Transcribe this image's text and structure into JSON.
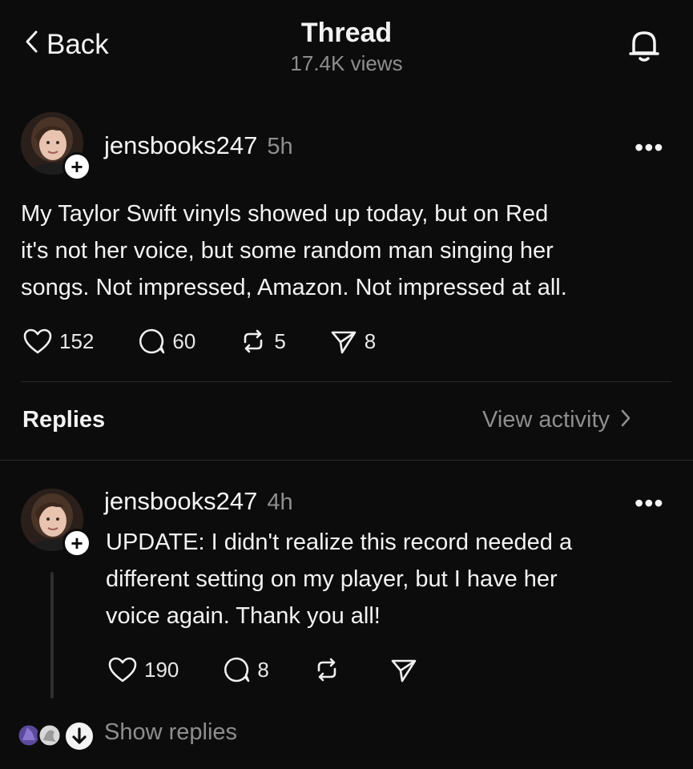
{
  "header": {
    "back_label": "Back",
    "title": "Thread",
    "views": "17.4K views",
    "icons": {
      "back": "chevron-left-icon",
      "notifications": "bell-icon"
    }
  },
  "post": {
    "username": "jensbooks247",
    "time": "5h",
    "more": "•••",
    "text_lines": [
      "My Taylor Swift vinyls showed up today, but on Red",
      "it's not her voice, but some random man singing her",
      "songs. Not impressed, Amazon. Not impressed at all."
    ],
    "likes": "152",
    "comments": "60",
    "reposts": "5",
    "shares": "8"
  },
  "replies_section": {
    "label": "Replies",
    "view_activity": "View activity"
  },
  "reply": {
    "username": "jensbooks247",
    "time": "4h",
    "more": "•••",
    "text_lines": [
      "UPDATE: I didn't realize this record needed a",
      "different setting on my player, but I have her",
      "voice again. Thank you all!"
    ],
    "likes": "190",
    "comments": "8",
    "show_replies": "Show replies"
  },
  "colors": {
    "background": "#0c0c0c",
    "text": "#f3f3f3",
    "muted": "#8e8e8e",
    "divider": "#2a2a2a"
  }
}
